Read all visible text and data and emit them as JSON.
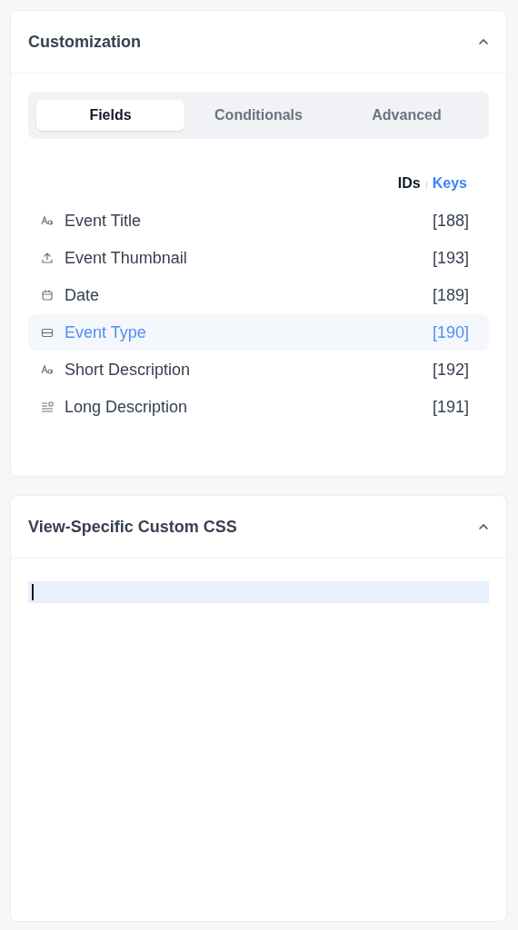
{
  "panels": [
    {
      "title": "Customization",
      "expanded": true,
      "tabs": [
        {
          "label": "Fields",
          "selected": true
        },
        {
          "label": "Conditionals",
          "selected": false
        },
        {
          "label": "Advanced",
          "selected": false
        }
      ],
      "toggle": [
        {
          "label": "IDs",
          "selected": true
        },
        {
          "label": "Keys",
          "selected": false
        }
      ],
      "fields": [
        {
          "kind": "text",
          "label": "Event Title",
          "id": "[188]",
          "selected": false
        },
        {
          "kind": "upload",
          "label": "Event Thumbnail",
          "id": "[193]",
          "selected": false
        },
        {
          "kind": "date",
          "label": "Date",
          "id": "[189]",
          "selected": false
        },
        {
          "kind": "select",
          "label": "Event Type",
          "id": "[190]",
          "selected": true
        },
        {
          "kind": "text",
          "label": "Short Description",
          "id": "[192]",
          "selected": false
        },
        {
          "kind": "textarea",
          "label": "Long Description",
          "id": "[191]",
          "selected": false
        }
      ]
    },
    {
      "title": "View-Specific Custom CSS",
      "expanded": true,
      "editor": {
        "focused": true
      }
    }
  ]
}
